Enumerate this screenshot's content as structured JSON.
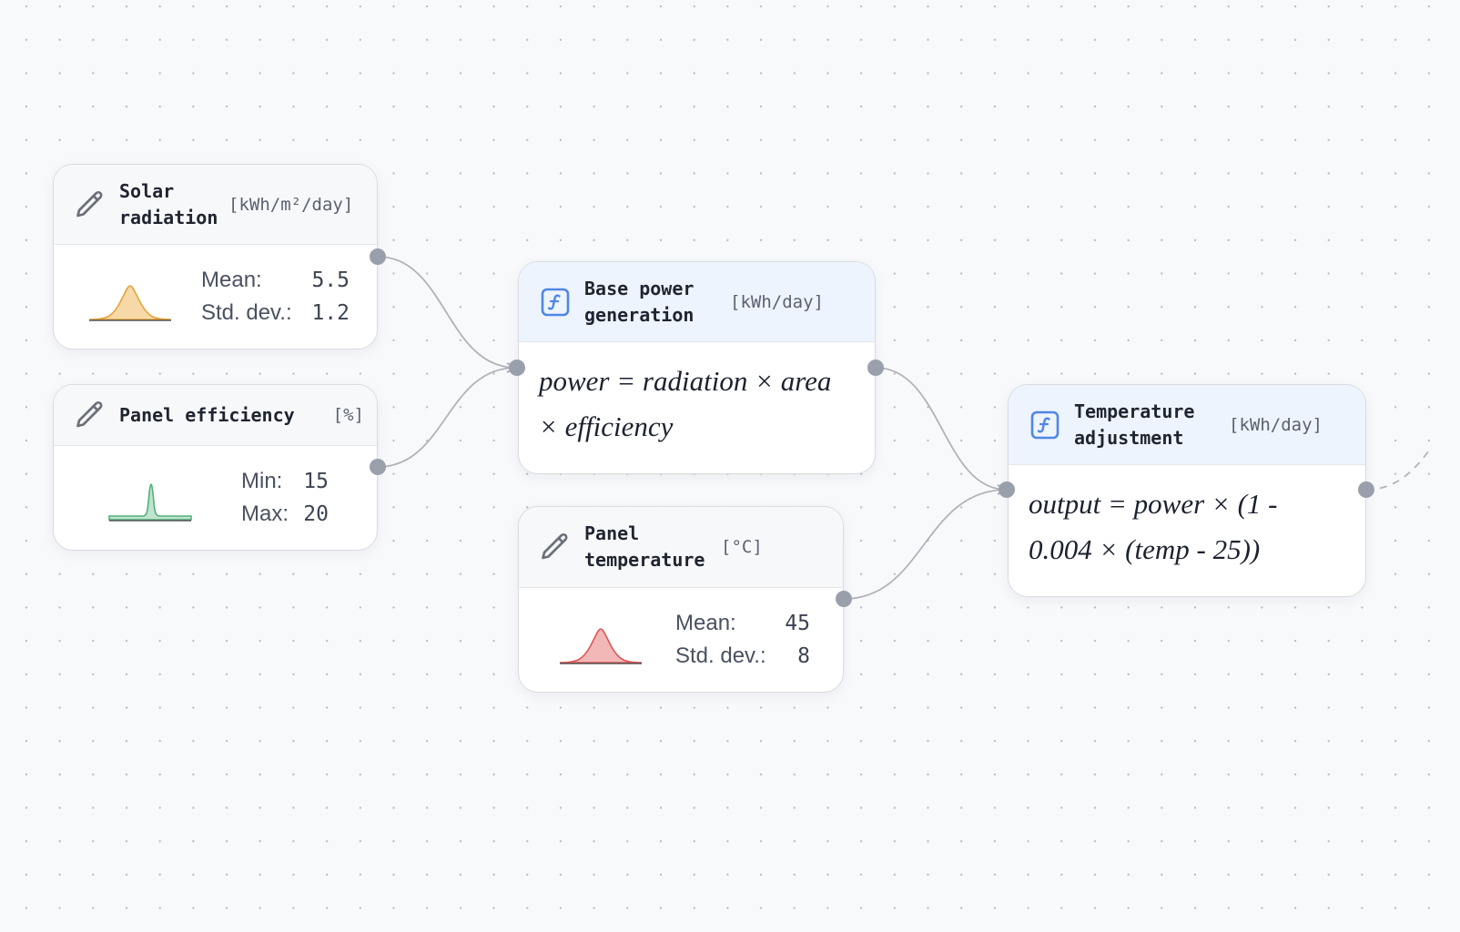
{
  "canvas": {
    "background": "#f8f9fb",
    "grid": "dots"
  },
  "nodes": {
    "solar_radiation": {
      "type": "input",
      "icon": "pencil-icon",
      "title": "Solar radiation",
      "unit": "[kWh/m²/day]",
      "distribution": {
        "kind": "normal",
        "color": "#e8a23a",
        "fill": "#f7d9a8"
      },
      "stats": [
        {
          "label": "Mean:",
          "value": "5.5"
        },
        {
          "label": "Std. dev.:",
          "value": "1.2"
        }
      ]
    },
    "panel_efficiency": {
      "type": "input",
      "icon": "pencil-icon",
      "title": "Panel efficiency",
      "unit": "[%]",
      "distribution": {
        "kind": "uniform-peak",
        "color": "#52b27c",
        "fill": "#bfe3cd"
      },
      "stats": [
        {
          "label": "Min:",
          "value": "15"
        },
        {
          "label": "Max:",
          "value": "20"
        }
      ]
    },
    "base_power": {
      "type": "function",
      "icon": "function-icon",
      "title": "Base power generation",
      "unit": "[kWh/day]",
      "formula": "power = radiation × area × efficiency"
    },
    "panel_temperature": {
      "type": "input",
      "icon": "pencil-icon",
      "title": "Panel temperature",
      "unit": "[°C]",
      "distribution": {
        "kind": "normal",
        "color": "#dd5555",
        "fill": "#f2b8b8"
      },
      "stats": [
        {
          "label": "Mean:",
          "value": "45"
        },
        {
          "label": "Std. dev.:",
          "value": "8"
        }
      ]
    },
    "temp_adjustment": {
      "type": "function",
      "icon": "function-icon",
      "title": "Temperature adjustment",
      "unit": "[kWh/day]",
      "formula": "output = power × (1 - 0.004 × (temp - 25))"
    }
  },
  "edges": [
    {
      "from": "solar_radiation",
      "to": "base_power",
      "style": "solid"
    },
    {
      "from": "panel_efficiency",
      "to": "base_power",
      "style": "solid"
    },
    {
      "from": "base_power",
      "to": "temp_adjustment",
      "style": "solid"
    },
    {
      "from": "panel_temperature",
      "to": "temp_adjustment",
      "style": "solid"
    },
    {
      "from": "temp_adjustment",
      "to": "offscreen",
      "style": "dashed"
    }
  ],
  "colors": {
    "port": "#9aa0ab",
    "edge": "#b0b3b9",
    "function_accent": "#4f86e8",
    "icon_gray": "#6b7079"
  }
}
